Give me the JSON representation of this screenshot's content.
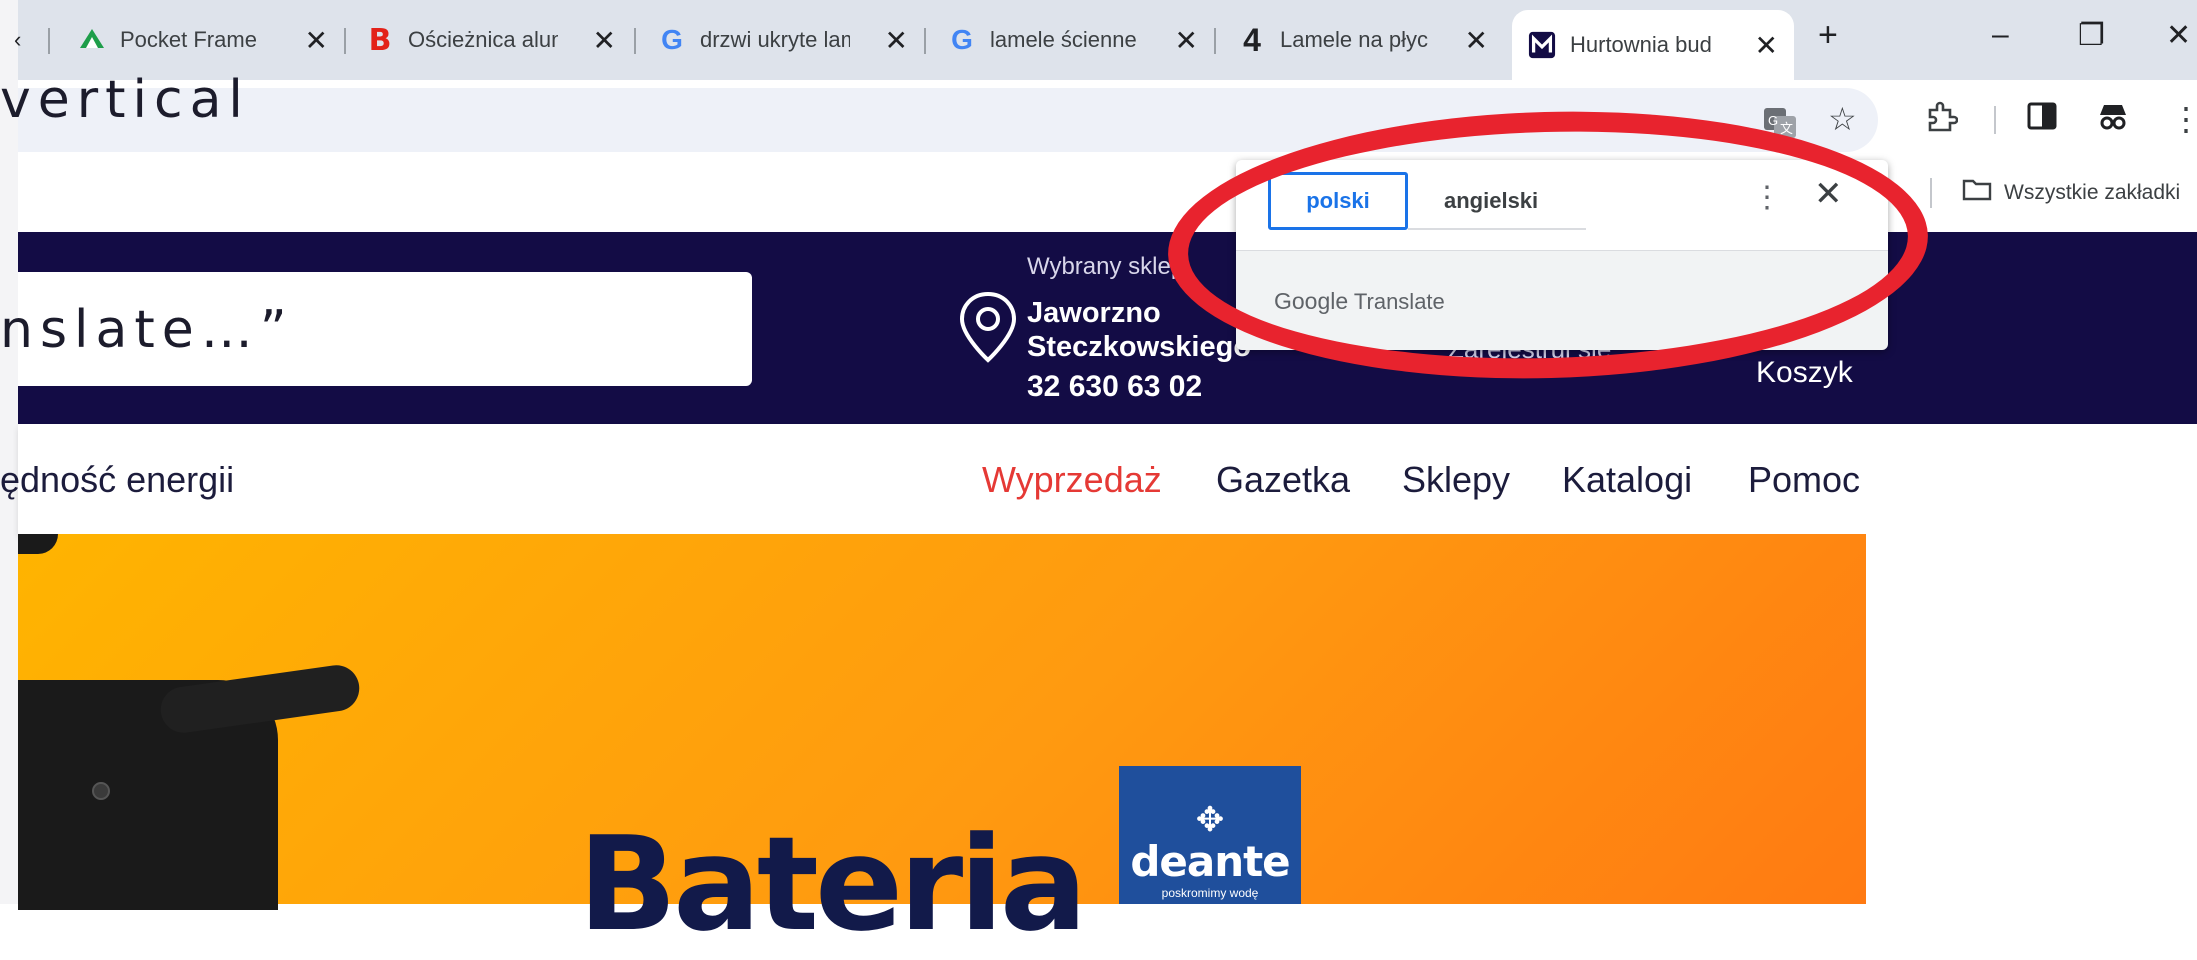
{
  "browser": {
    "tabs": [
      {
        "title": "",
        "favicon": "partial-tab-close",
        "x": 0
      },
      {
        "title": "Pocket Frame |",
        "favicon": "green-triangle-icon"
      },
      {
        "title": "Ościeżnica alum",
        "favicon": "b-red-icon"
      },
      {
        "title": "drzwi ukryte lam",
        "favicon": "google-g-icon"
      },
      {
        "title": "lamele ścienne",
        "favicon": "google-g-icon"
      },
      {
        "title": "Lamele na płyc",
        "favicon": "four-icon"
      },
      {
        "title": "Hurtownia bud",
        "favicon": "m-logo-icon",
        "active": true
      }
    ],
    "new_tab": "+",
    "window_controls": {
      "minimize": "–",
      "restore": "❐",
      "close": "✕"
    },
    "bookmarks": {
      "all_bookmarks": "Wszystkie zakładki"
    }
  },
  "overlay_text": {
    "top": "vertical",
    "middle": "nslate…”"
  },
  "translate_popup": {
    "source_lang": "polski",
    "target_lang": "angielski",
    "more": "⋮",
    "close": "✕",
    "brand_google": "Google",
    "brand_translate": "Translate"
  },
  "site": {
    "header": {
      "store_label": "Wybrany sklep:",
      "store_name_1": "Jaworzno",
      "store_name_2": "Steczkowskiego",
      "store_phone": "32 630 63 02",
      "register": "Zarejestruj się",
      "cart": "Koszyk"
    },
    "nav": {
      "left_partial": "ędność energii",
      "links": [
        "Wyprzedaż",
        "Gazetka",
        "Sklepy",
        "Katalogi",
        "Pomoc"
      ],
      "sale_color": "#e53935"
    },
    "banner": {
      "headline": "Bateria",
      "brand_name": "deante",
      "brand_tagline": "poskromimy wodę"
    }
  },
  "colors": {
    "header_bg": "#130c45",
    "annotation_red": "#e8232e",
    "translate_active": "#1a73e8"
  }
}
